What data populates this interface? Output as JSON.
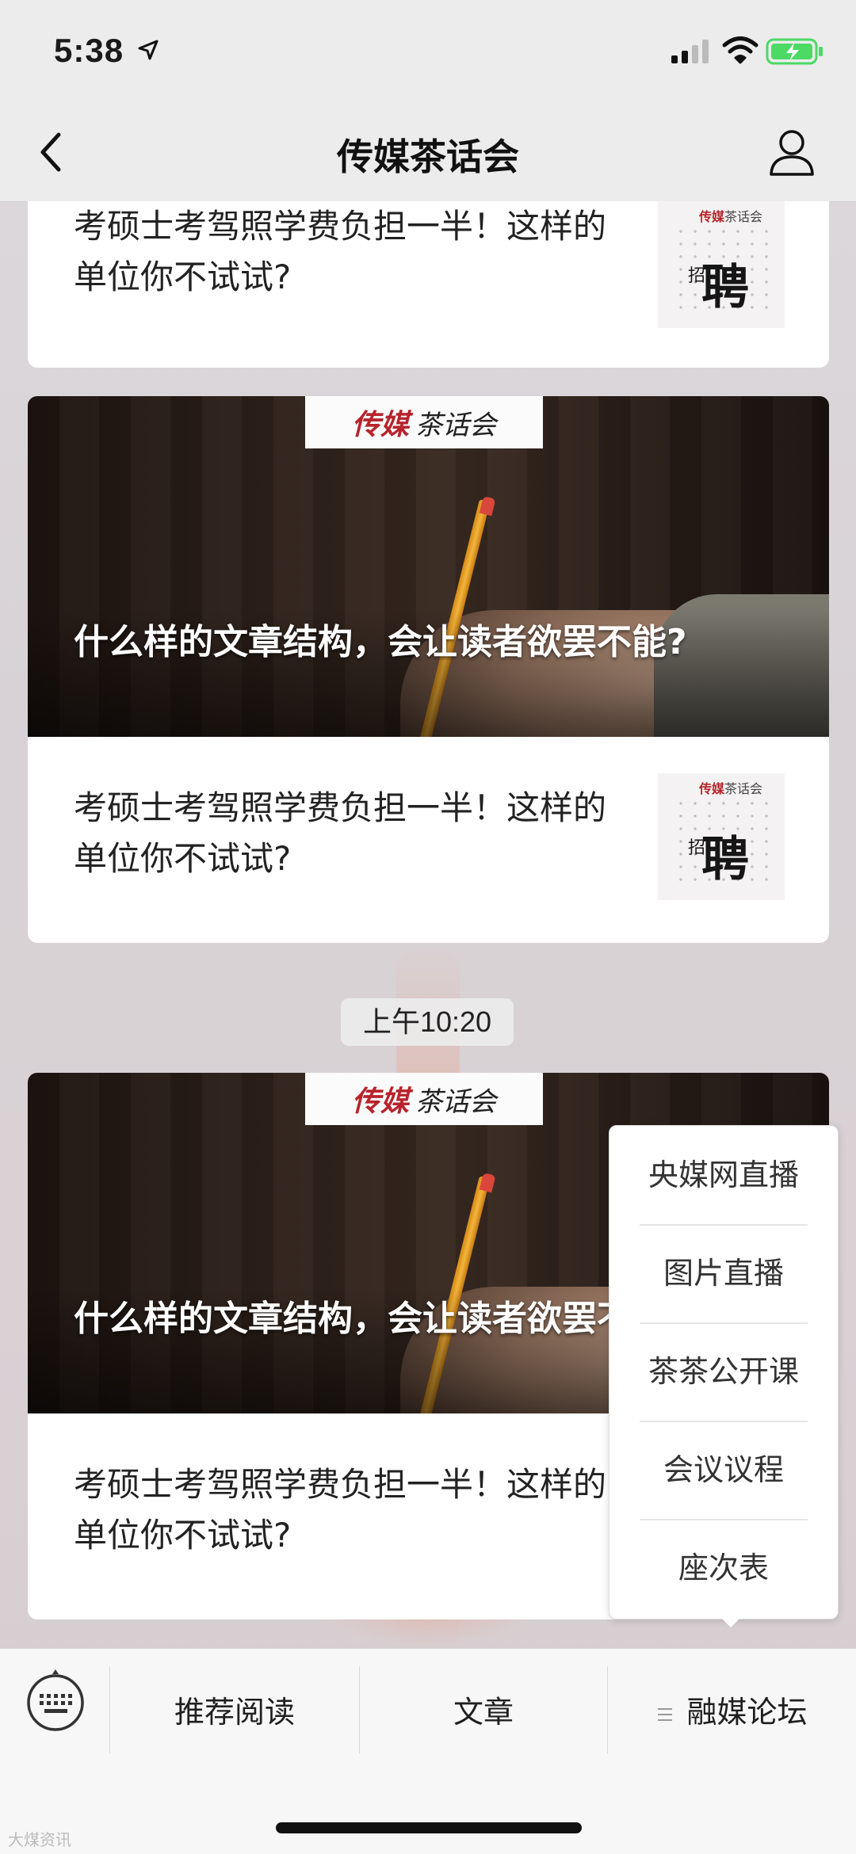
{
  "status_bar": {
    "time": "5:38"
  },
  "nav": {
    "title": "传媒茶话会"
  },
  "brand": {
    "red": "传媒",
    "black": "茶话会"
  },
  "thumb": {
    "brand_red": "传媒",
    "brand_black": "茶话会",
    "char_small": "招",
    "char_big": "聘"
  },
  "messages": [
    {
      "item_title": "考硕士考驾照学费负担一半！这样的单位你不试试?"
    },
    {
      "cover_title": "什么样的文章结构，会让读者欲罢不能?",
      "item_title": "考硕士考驾照学费负担一半！这样的单位你不试试?"
    },
    {
      "cover_title": "什么样的文章结构，会让读者欲罢不能?",
      "item_title": "考硕士考驾照学费负担一半！这样的单位你不试试?"
    }
  ],
  "timestamp": "上午10:20",
  "popup_menu": [
    "央媒网直播",
    "图片直播",
    "茶茶公开课",
    "会议议程",
    "座次表"
  ],
  "bottom_menu": {
    "items": [
      "推荐阅读",
      "文章",
      "融媒论坛"
    ]
  },
  "watermark": "大煤资讯",
  "colors": {
    "brand_red": "#b8232b",
    "nav_bg": "#ececec",
    "battery_green": "#4cd964"
  }
}
